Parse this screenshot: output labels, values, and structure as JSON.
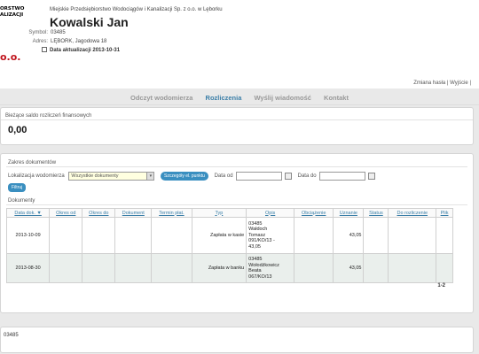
{
  "logo": {
    "line1": "ORSTWO",
    "line2": "ALIZACJI",
    "red_text": "o.o."
  },
  "header": {
    "company": "Miejskie Przedsiębiorstwo Wodociągów i Kanalizacji Sp. z o.o. w Lęborku",
    "name": "Kowalski Jan",
    "symbol_label": "Symbol:",
    "symbol_value": "03485",
    "address_label": "Adres:",
    "address_value": "LĘBORK, Jagodowa 18",
    "update_text": "Data aktualizacji 2013-10-31"
  },
  "top_links": {
    "change_password": "Zmiana hasła",
    "separator": "|",
    "logout": "Wyjście",
    "end_sep": "|"
  },
  "tabs": [
    {
      "label": "Odczyt wodomierza"
    },
    {
      "label": "Rozliczenia"
    },
    {
      "label": "Wyślij wiadomość"
    },
    {
      "label": "Kontakt"
    }
  ],
  "saldo": {
    "title": "Bieżące saldo rozliczeń finansowych",
    "value": "0,00"
  },
  "docs": {
    "section_title": "Zakres dokumentów",
    "location_label": "Lokalizacja wodomierza",
    "location_selected": "Wszystkie dokumenty",
    "details_button": "Szczegóły el. punktu",
    "date_from_label": "Data od",
    "date_to_label": "Data do",
    "filter_button": "Filtruj",
    "list_title": "Dokumenty",
    "columns": [
      "Data dok. ▼",
      "Okres od",
      "Okres do",
      "Dokument",
      "Termin płat.",
      "Typ",
      "Opis",
      "Obciążenie",
      "Uznanie",
      "Status",
      "Do rozliczenie",
      "Plik"
    ],
    "rows": [
      {
        "date": "2013-10-09",
        "type": "Zapłata w kasie",
        "desc": [
          "03485",
          "Wałdoch",
          "Tomasz",
          "091/KO/13 -",
          "43,05"
        ],
        "credit": "43,05"
      },
      {
        "date": "2013-08-30",
        "type": "Zapłata w banku",
        "desc": [
          "03485",
          "Wołodźkowicz",
          "Beata",
          "067/KO/13"
        ],
        "credit": "43,05"
      }
    ],
    "pager": "1-2"
  },
  "bottom": {
    "code": "03485"
  },
  "colors": {
    "accent": "#3a8fc0",
    "active_tab": "#3c7fa8",
    "logo_red": "#c0141c"
  }
}
